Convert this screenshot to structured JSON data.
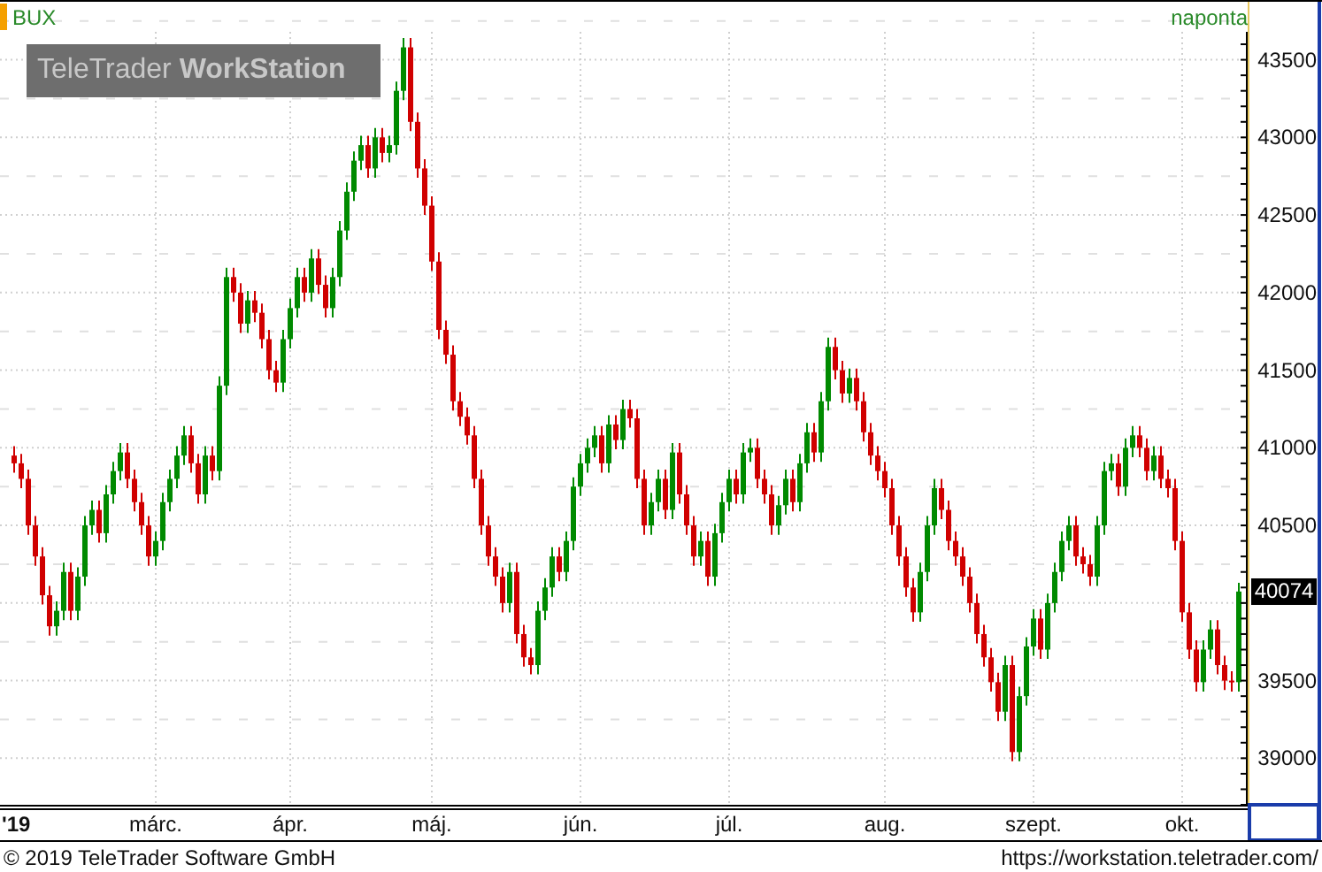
{
  "chart": {
    "interval": "naponta",
    "logo": "TeleTrader **WorkStation**",
    "chart_data": {
      "type": "candlestick",
      "title": "BUX",
      "grid": true,
      "categories": [
        "'19",
        null,
        null,
        null,
        null,
        null,
        null,
        null,
        null,
        null,
        null,
        null,
        null,
        null,
        null,
        null,
        null,
        null,
        null,
        null,
        "márc.",
        null,
        null,
        null,
        null,
        null,
        null,
        null,
        null,
        null,
        null,
        null,
        null,
        null,
        null,
        null,
        null,
        null,
        null,
        "ápr.",
        null,
        null,
        null,
        null,
        null,
        null,
        null,
        null,
        null,
        null,
        null,
        null,
        null,
        null,
        null,
        null,
        null,
        null,
        null,
        "máj.",
        null,
        null,
        null,
        null,
        null,
        null,
        null,
        null,
        null,
        null,
        null,
        null,
        null,
        null,
        null,
        null,
        null,
        null,
        null,
        null,
        "jún.",
        null,
        null,
        null,
        null,
        null,
        null,
        null,
        null,
        null,
        null,
        null,
        null,
        null,
        null,
        null,
        null,
        null,
        null,
        null,
        null,
        "júl.",
        null,
        null,
        null,
        null,
        null,
        null,
        null,
        null,
        null,
        null,
        null,
        null,
        null,
        null,
        null,
        null,
        null,
        null,
        null,
        null,
        null,
        "aug.",
        null,
        null,
        null,
        null,
        null,
        null,
        null,
        null,
        null,
        null,
        null,
        null,
        null,
        null,
        null,
        null,
        null,
        null,
        null,
        null,
        "szept.",
        null,
        null,
        null,
        null,
        null,
        null,
        null,
        null,
        null,
        null,
        null,
        null,
        null,
        null,
        null,
        null,
        null,
        null,
        null,
        null,
        "okt.",
        null,
        null,
        null,
        null,
        null,
        null,
        null,
        null
      ],
      "ohlc": [
        [
          40950,
          41010,
          40840,
          40900
        ],
        [
          40900,
          40960,
          40740,
          40800
        ],
        [
          40800,
          40860,
          40440,
          40500
        ],
        [
          40500,
          40560,
          40240,
          40300
        ],
        [
          40300,
          40360,
          39990,
          40050
        ],
        [
          40050,
          40110,
          39790,
          39850
        ],
        [
          39850,
          40010,
          39790,
          39950
        ],
        [
          39950,
          40260,
          39890,
          40200
        ],
        [
          40200,
          40260,
          39890,
          39950
        ],
        [
          39950,
          40230,
          39890,
          40170
        ],
        [
          40170,
          40560,
          40110,
          40500
        ],
        [
          40500,
          40660,
          40440,
          40600
        ],
        [
          40600,
          40660,
          40390,
          40450
        ],
        [
          40450,
          40760,
          40390,
          40700
        ],
        [
          40700,
          40910,
          40640,
          40850
        ],
        [
          40850,
          41030,
          40790,
          40970
        ],
        [
          40970,
          41030,
          40740,
          40800
        ],
        [
          40800,
          40860,
          40590,
          40650
        ],
        [
          40650,
          40710,
          40440,
          40500
        ],
        [
          40500,
          40560,
          40240,
          40300
        ],
        [
          40300,
          40460,
          40240,
          40400
        ],
        [
          40400,
          40710,
          40340,
          40650
        ],
        [
          40650,
          40860,
          40590,
          40800
        ],
        [
          40800,
          41010,
          40740,
          40950
        ],
        [
          40950,
          41140,
          40890,
          41080
        ],
        [
          41080,
          41140,
          40840,
          40900
        ],
        [
          40900,
          40960,
          40640,
          40700
        ],
        [
          40700,
          41010,
          40640,
          40950
        ],
        [
          40950,
          41010,
          40790,
          40850
        ],
        [
          40850,
          41460,
          40790,
          41400
        ],
        [
          41400,
          42160,
          41340,
          42100
        ],
        [
          42100,
          42160,
          41940,
          42000
        ],
        [
          42000,
          42060,
          41740,
          41800
        ],
        [
          41800,
          42010,
          41740,
          41950
        ],
        [
          41950,
          42010,
          41810,
          41870
        ],
        [
          41870,
          41930,
          41640,
          41700
        ],
        [
          41700,
          41760,
          41440,
          41500
        ],
        [
          41500,
          41560,
          41360,
          41420
        ],
        [
          41420,
          41760,
          41360,
          41700
        ],
        [
          41700,
          41960,
          41640,
          41900
        ],
        [
          41900,
          42160,
          41840,
          42100
        ],
        [
          42100,
          42160,
          41940,
          42000
        ],
        [
          42000,
          42280,
          41940,
          42220
        ],
        [
          42220,
          42280,
          41990,
          42050
        ],
        [
          42050,
          42110,
          41840,
          41900
        ],
        [
          41900,
          42160,
          41840,
          42100
        ],
        [
          42100,
          42460,
          42040,
          42400
        ],
        [
          42400,
          42710,
          42340,
          42650
        ],
        [
          42650,
          42910,
          42590,
          42850
        ],
        [
          42850,
          43010,
          42790,
          42950
        ],
        [
          42950,
          43010,
          42740,
          42800
        ],
        [
          42800,
          43060,
          42740,
          43000
        ],
        [
          43000,
          43060,
          42840,
          42900
        ],
        [
          42900,
          43010,
          42840,
          42950
        ],
        [
          42950,
          43360,
          42890,
          43300
        ],
        [
          43300,
          43640,
          43240,
          43580
        ],
        [
          43580,
          43640,
          43040,
          43100
        ],
        [
          43100,
          43160,
          42740,
          42800
        ],
        [
          42800,
          42860,
          42500,
          42560
        ],
        [
          42560,
          42620,
          42140,
          42200
        ],
        [
          42200,
          42260,
          41700,
          41760
        ],
        [
          41760,
          41820,
          41540,
          41600
        ],
        [
          41600,
          41660,
          41240,
          41300
        ],
        [
          41300,
          41360,
          41140,
          41200
        ],
        [
          41200,
          41260,
          41020,
          41080
        ],
        [
          41080,
          41140,
          40740,
          40800
        ],
        [
          40800,
          40860,
          40440,
          40500
        ],
        [
          40500,
          40560,
          40240,
          40300
        ],
        [
          40300,
          40360,
          40110,
          40170
        ],
        [
          40170,
          40230,
          39940,
          40000
        ],
        [
          40000,
          40260,
          39940,
          40200
        ],
        [
          40200,
          40260,
          39740,
          39800
        ],
        [
          39800,
          39860,
          39590,
          39650
        ],
        [
          39650,
          39710,
          39540,
          39600
        ],
        [
          39600,
          40010,
          39540,
          39950
        ],
        [
          39950,
          40160,
          39890,
          40100
        ],
        [
          40100,
          40360,
          40040,
          40300
        ],
        [
          40300,
          40360,
          40140,
          40200
        ],
        [
          40200,
          40460,
          40140,
          40400
        ],
        [
          40400,
          40810,
          40340,
          40750
        ],
        [
          40750,
          40960,
          40690,
          40900
        ],
        [
          40900,
          41060,
          40840,
          41000
        ],
        [
          41000,
          41140,
          40940,
          41080
        ],
        [
          41080,
          41140,
          40840,
          40900
        ],
        [
          40900,
          41210,
          40840,
          41150
        ],
        [
          41150,
          41210,
          40990,
          41050
        ],
        [
          41050,
          41310,
          40990,
          41250
        ],
        [
          41250,
          41310,
          41130,
          41190
        ],
        [
          41190,
          41250,
          40740,
          40800
        ],
        [
          40800,
          40860,
          40440,
          40500
        ],
        [
          40500,
          40710,
          40440,
          40650
        ],
        [
          40650,
          40860,
          40590,
          40800
        ],
        [
          40800,
          40860,
          40540,
          40600
        ],
        [
          40600,
          41030,
          40540,
          40970
        ],
        [
          40970,
          41030,
          40640,
          40700
        ],
        [
          40700,
          40760,
          40440,
          40500
        ],
        [
          40500,
          40560,
          40240,
          40300
        ],
        [
          40300,
          40460,
          40240,
          40400
        ],
        [
          40400,
          40460,
          40110,
          40170
        ],
        [
          40170,
          40510,
          40110,
          40450
        ],
        [
          40450,
          40710,
          40390,
          40650
        ],
        [
          40650,
          40860,
          40590,
          40800
        ],
        [
          40800,
          40860,
          40640,
          40700
        ],
        [
          40700,
          41030,
          40640,
          40970
        ],
        [
          40970,
          41060,
          40910,
          41000
        ],
        [
          41000,
          41060,
          40740,
          40800
        ],
        [
          40800,
          40860,
          40640,
          40700
        ],
        [
          40700,
          40760,
          40440,
          40500
        ],
        [
          40500,
          40690,
          40440,
          40630
        ],
        [
          40630,
          40860,
          40570,
          40800
        ],
        [
          40800,
          40860,
          40590,
          40650
        ],
        [
          40650,
          40960,
          40590,
          40900
        ],
        [
          40900,
          41160,
          40840,
          41100
        ],
        [
          41100,
          41160,
          40910,
          40970
        ],
        [
          40970,
          41360,
          40910,
          41300
        ],
        [
          41300,
          41710,
          41240,
          41650
        ],
        [
          41650,
          41710,
          41440,
          41500
        ],
        [
          41500,
          41560,
          41290,
          41350
        ],
        [
          41350,
          41510,
          41290,
          41450
        ],
        [
          41450,
          41510,
          41240,
          41300
        ],
        [
          41300,
          41360,
          41040,
          41100
        ],
        [
          41100,
          41160,
          40890,
          40950
        ],
        [
          40950,
          41010,
          40790,
          40850
        ],
        [
          40850,
          40910,
          40680,
          40740
        ],
        [
          40740,
          40800,
          40440,
          40500
        ],
        [
          40500,
          40560,
          40240,
          40300
        ],
        [
          40300,
          40360,
          40040,
          40100
        ],
        [
          40100,
          40160,
          39880,
          39940
        ],
        [
          39940,
          40260,
          39880,
          40200
        ],
        [
          40200,
          40560,
          40140,
          40500
        ],
        [
          40500,
          40800,
          40440,
          40740
        ],
        [
          40740,
          40800,
          40540,
          40600
        ],
        [
          40600,
          40660,
          40340,
          40400
        ],
        [
          40400,
          40460,
          40240,
          40300
        ],
        [
          40300,
          40360,
          40110,
          40170
        ],
        [
          40170,
          40230,
          39940,
          40000
        ],
        [
          40000,
          40060,
          39740,
          39800
        ],
        [
          39800,
          39860,
          39590,
          39650
        ],
        [
          39650,
          39710,
          39430,
          39490
        ],
        [
          39490,
          39550,
          39240,
          39300
        ],
        [
          39300,
          39660,
          39240,
          39600
        ],
        [
          39600,
          39660,
          38980,
          39040
        ],
        [
          39040,
          39460,
          38980,
          39400
        ],
        [
          39400,
          39780,
          39340,
          39720
        ],
        [
          39720,
          39960,
          39660,
          39900
        ],
        [
          39900,
          39960,
          39640,
          39700
        ],
        [
          39700,
          40060,
          39640,
          40000
        ],
        [
          40000,
          40260,
          39940,
          40200
        ],
        [
          40200,
          40460,
          40140,
          40400
        ],
        [
          40400,
          40560,
          40340,
          40500
        ],
        [
          40500,
          40560,
          40240,
          40300
        ],
        [
          40300,
          40360,
          40190,
          40250
        ],
        [
          40250,
          40310,
          40110,
          40170
        ],
        [
          40170,
          40560,
          40110,
          40500
        ],
        [
          40500,
          40910,
          40440,
          40850
        ],
        [
          40850,
          40960,
          40790,
          40900
        ],
        [
          40900,
          40960,
          40690,
          40750
        ],
        [
          40750,
          41060,
          40690,
          41000
        ],
        [
          41000,
          41140,
          40940,
          41080
        ],
        [
          41080,
          41140,
          40940,
          41000
        ],
        [
          41000,
          41060,
          40790,
          40850
        ],
        [
          40850,
          41010,
          40790,
          40950
        ],
        [
          40950,
          41010,
          40740,
          40800
        ],
        [
          40800,
          40860,
          40680,
          40740
        ],
        [
          40740,
          40800,
          40340,
          40400
        ],
        [
          40400,
          40460,
          39880,
          39940
        ],
        [
          39940,
          40000,
          39640,
          39700
        ],
        [
          39700,
          39760,
          39430,
          39490
        ],
        [
          39490,
          39760,
          39430,
          39700
        ],
        [
          39700,
          39890,
          39640,
          39830
        ],
        [
          39830,
          39890,
          39540,
          39600
        ],
        [
          39600,
          39660,
          39440,
          39500
        ],
        [
          39500,
          39560,
          39430,
          39490
        ],
        [
          39490,
          40130,
          39430,
          40074
        ]
      ],
      "ylim": [
        38700,
        43680
      ],
      "yticks": [
        {
          "value": 43500,
          "label": "43500"
        },
        {
          "value": 43000,
          "label": "43000"
        },
        {
          "value": 42500,
          "label": "42500"
        },
        {
          "value": 42000,
          "label": "42000"
        },
        {
          "value": 41500,
          "label": "41500"
        },
        {
          "value": 41000,
          "label": "41000"
        },
        {
          "value": 40500,
          "label": "40500"
        },
        {
          "value": 39500,
          "label": "39500"
        },
        {
          "value": 39000,
          "label": "39000"
        }
      ],
      "annotations": [
        "40074"
      ]
    }
  },
  "footer": {
    "copyright": "© 2019 TeleTrader Software GmbH",
    "url": "https://workstation.teletrader.com/"
  }
}
